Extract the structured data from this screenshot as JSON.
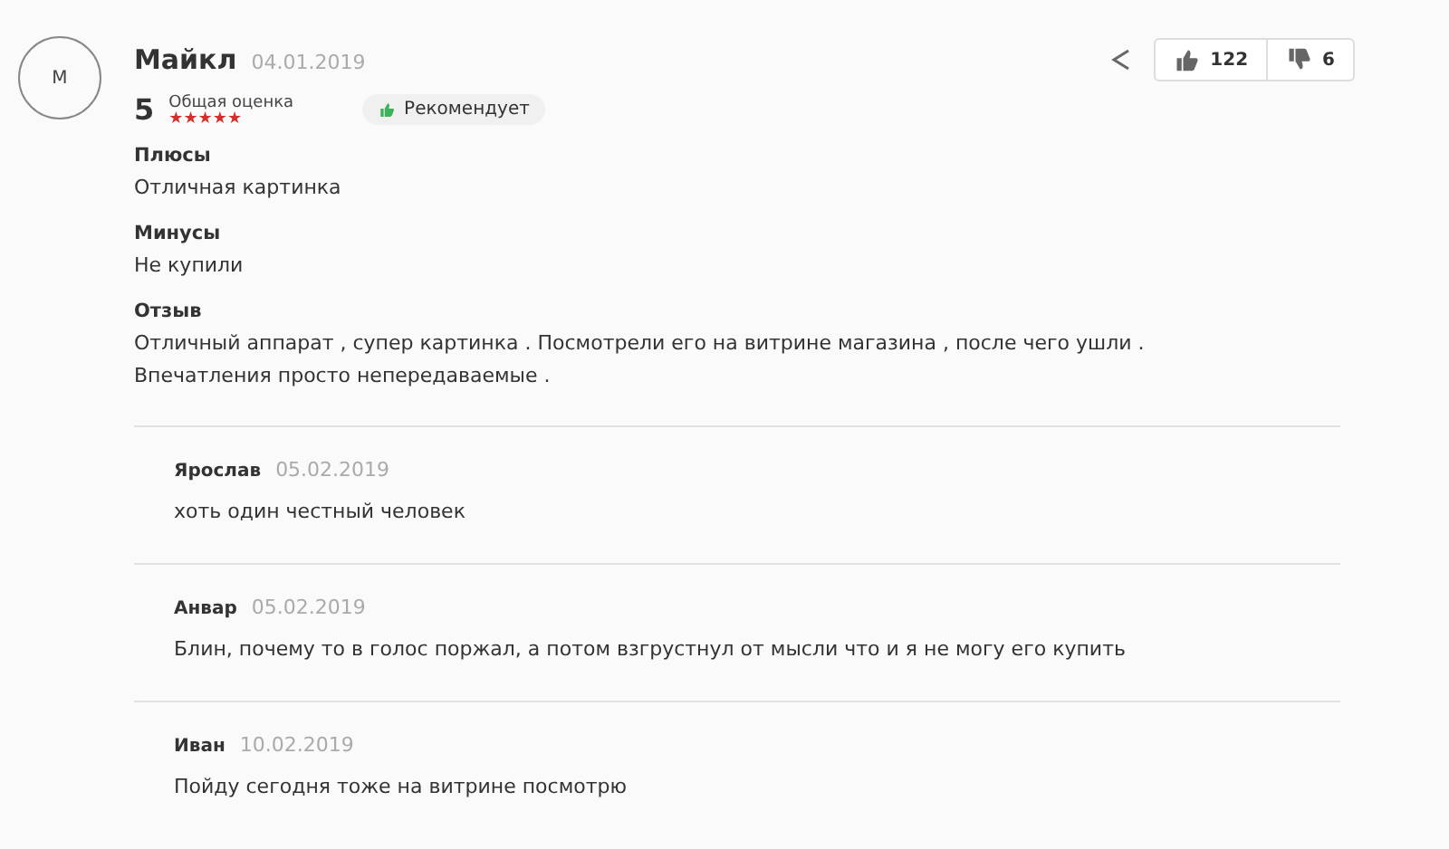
{
  "review": {
    "avatar": "М",
    "author": "Майкл",
    "date": "04.01.2019",
    "score": "5",
    "score_label": "Общая оценка",
    "stars": 5,
    "recommend": "Рекомендует",
    "likes": "122",
    "dislikes": "6",
    "sections": [
      {
        "title": "Плюсы",
        "text": "Отличная картинка"
      },
      {
        "title": "Минусы",
        "text": "Не купили"
      },
      {
        "title": "Отзыв",
        "text": "Отличный аппарат , супер картинка . Посмотрели его на витрине магазина , после чего ушли . Впечатления просто непередаваемые ."
      }
    ]
  },
  "replies": [
    {
      "author": "Ярослав",
      "date": "05.02.2019",
      "text": "хоть один честный человек"
    },
    {
      "author": "Анвар",
      "date": "05.02.2019",
      "text": "Блин, почему то в голос поржал, а потом взгрустнул от мысли что и я не могу его купить"
    },
    {
      "author": "Иван",
      "date": "10.02.2019",
      "text": "Пойду сегодня тоже на витрине посмотрю"
    }
  ]
}
